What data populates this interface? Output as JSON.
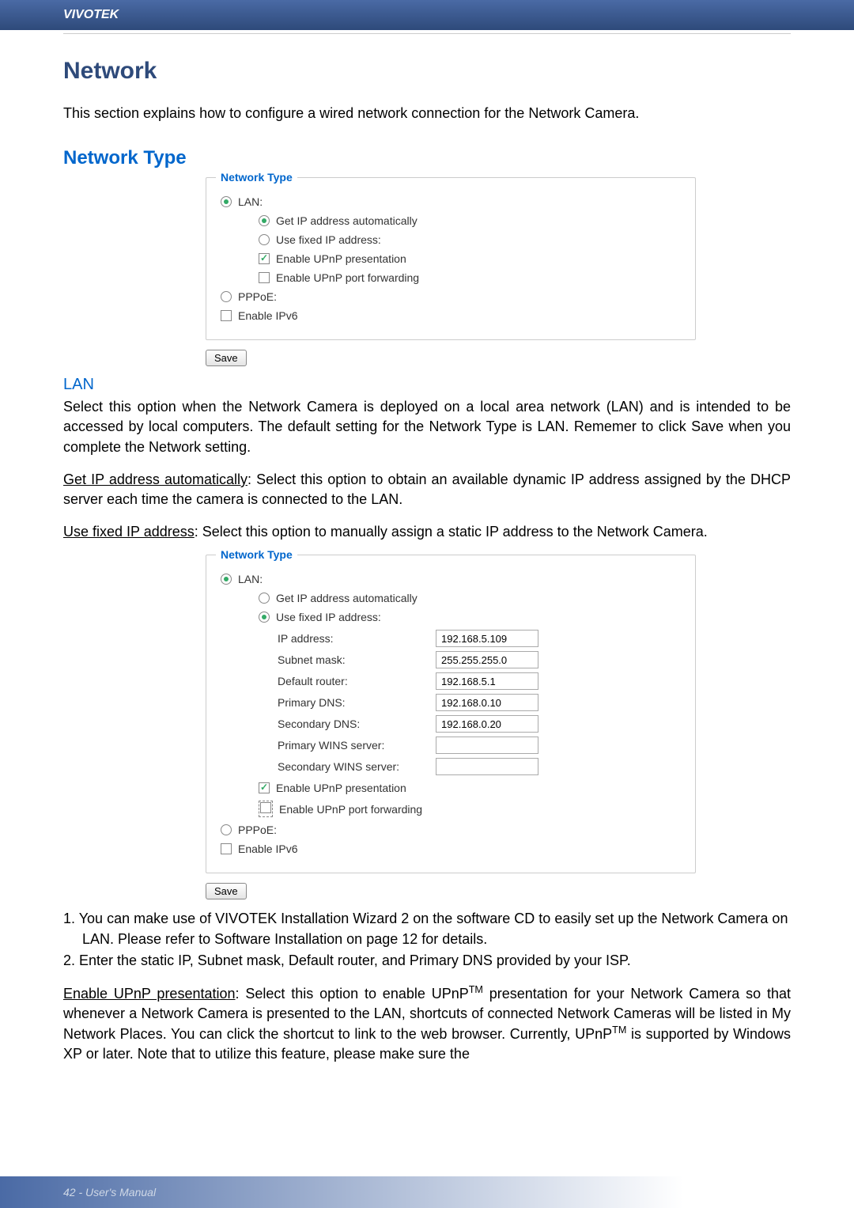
{
  "header": {
    "brand": "VIVOTEK"
  },
  "title": "Network",
  "intro": "This section explains how to configure a wired network connection for the Network Camera.",
  "networkTypeHeading": "Network Type",
  "panel1": {
    "legend": "Network Type",
    "lan": "LAN:",
    "getIpAuto": "Get IP address automatically",
    "useFixed": "Use fixed IP address:",
    "upnpPresentation": "Enable UPnP presentation",
    "upnpPortForward": "Enable UPnP port forwarding",
    "pppoe": "PPPoE:",
    "enableIpv6": "Enable IPv6",
    "save": "Save"
  },
  "lanHeading": "LAN",
  "lanPara": "Select this option when the Network Camera is deployed on a local area network (LAN) and is intended to be accessed by local computers. The default setting for the Network Type is LAN. Rememer to click Save when you complete the Network setting.",
  "getIpLabel": "Get IP address automatically",
  "getIpText": ": Select this option to obtain an available dynamic IP address assigned by the DHCP server each time the camera is connected to the LAN.",
  "useFixedLabel": "Use fixed IP address",
  "useFixedText": ": Select this option to manually assign a static IP address to the Network Camera.",
  "panel2": {
    "legend": "Network Type",
    "lan": "LAN:",
    "getIpAuto": "Get IP address automatically",
    "useFixed": "Use fixed IP address:",
    "fields": {
      "ipAddressLabel": "IP address:",
      "ipAddressValue": "192.168.5.109",
      "subnetLabel": "Subnet mask:",
      "subnetValue": "255.255.255.0",
      "routerLabel": "Default router:",
      "routerValue": "192.168.5.1",
      "pdnsLabel": "Primary DNS:",
      "pdnsValue": "192.168.0.10",
      "sdnsLabel": "Secondary DNS:",
      "sdnsValue": "192.168.0.20",
      "pwinsLabel": "Primary WINS server:",
      "pwinsValue": "",
      "swinsLabel": "Secondary WINS server:",
      "swinsValue": ""
    },
    "upnpPresentation": "Enable UPnP presentation",
    "upnpPortForward": "Enable UPnP port forwarding",
    "pppoe": "PPPoE:",
    "enableIpv6": "Enable IPv6",
    "save": "Save"
  },
  "step1": "1. You can make use of VIVOTEK Installation Wizard 2 on the software CD to easily set up the Network Camera on LAN. Please refer to Software Installation on page 12 for details.",
  "step2": "2. Enter the static IP, Subnet mask, Default router, and Primary DNS provided by your ISP.",
  "enableUpnpLabel": "Enable UPnP presentation",
  "enableUpnpText1": ": Select this option to enable UPnP",
  "enableUpnpTM": "TM",
  "enableUpnpText2": " presentation for your Network Camera so that whenever a Network Camera is presented to the LAN, shortcuts of connected Network Cameras will be listed in My Network Places. You can click the shortcut to link to the web browser. Currently, UPnP",
  "enableUpnpText3": " is supported by Windows XP or later. Note that to utilize this feature, please make sure the",
  "footer": "42 - User's Manual"
}
